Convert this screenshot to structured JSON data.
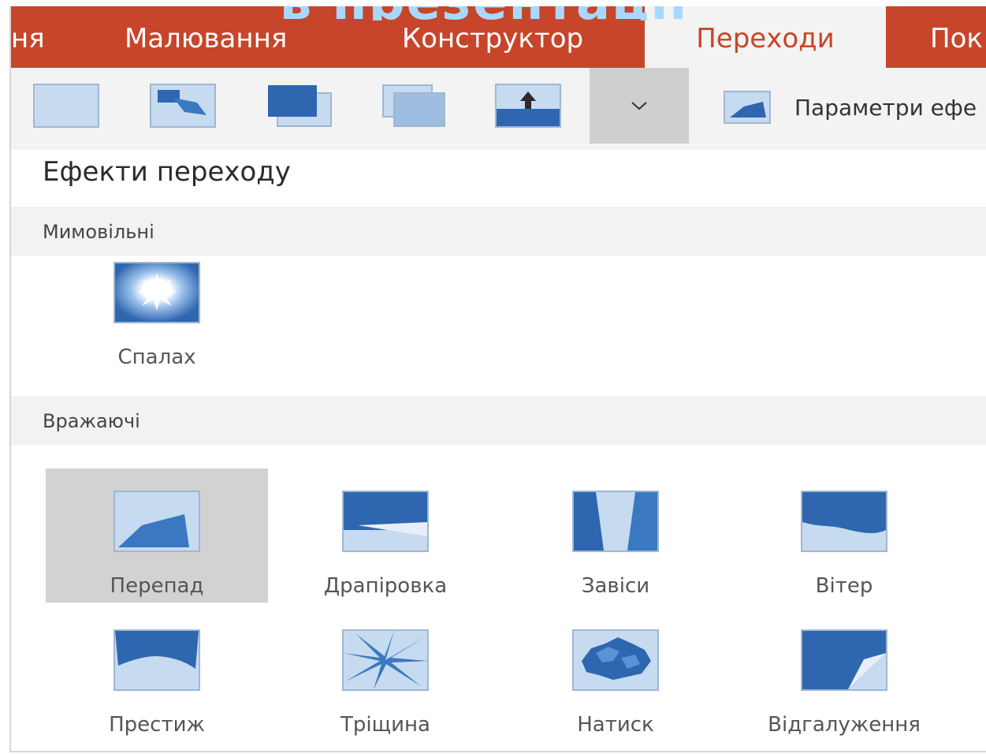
{
  "overlay_title": "в презентації",
  "tabs": [
    {
      "label": "ня",
      "active": false
    },
    {
      "label": "Малювання",
      "active": false
    },
    {
      "label": "Конструктор",
      "active": false
    },
    {
      "label": "Переходи",
      "active": true
    },
    {
      "label": "Пок",
      "active": false
    }
  ],
  "ribbon": {
    "effect_options_label": "Параметри ефе",
    "buttons": [
      "none-transition-icon",
      "morph-transition-icon",
      "fade-transition-icon",
      "push-transition-icon",
      "wipe-transition-icon"
    ],
    "dropdown_icon": "chevron-down-icon"
  },
  "panel": {
    "title": "Ефекти переходу",
    "sections": [
      {
        "label": "Мимовільні",
        "items": [
          {
            "label": "Спалах",
            "icon": "flash-icon",
            "selected": false
          }
        ]
      },
      {
        "label": "Вражаючі",
        "items": [
          {
            "label": "Перепад",
            "icon": "fall-over-icon",
            "selected": true
          },
          {
            "label": "Драпіровка",
            "icon": "drape-icon",
            "selected": false
          },
          {
            "label": "Завіси",
            "icon": "curtains-icon",
            "selected": false
          },
          {
            "label": "Вітер",
            "icon": "wind-icon",
            "selected": false
          },
          {
            "label": "Престиж",
            "icon": "prestige-icon",
            "selected": false
          },
          {
            "label": "Тріщина",
            "icon": "fracture-icon",
            "selected": false
          },
          {
            "label": "Натиск",
            "icon": "crush-icon",
            "selected": false
          },
          {
            "label": "Відгалуження",
            "icon": "peel-off-icon",
            "selected": false
          }
        ]
      }
    ]
  },
  "colors": {
    "accent": "#c7452a",
    "icon_blue": "#3a78c2",
    "icon_bg": "#c6daf0"
  }
}
